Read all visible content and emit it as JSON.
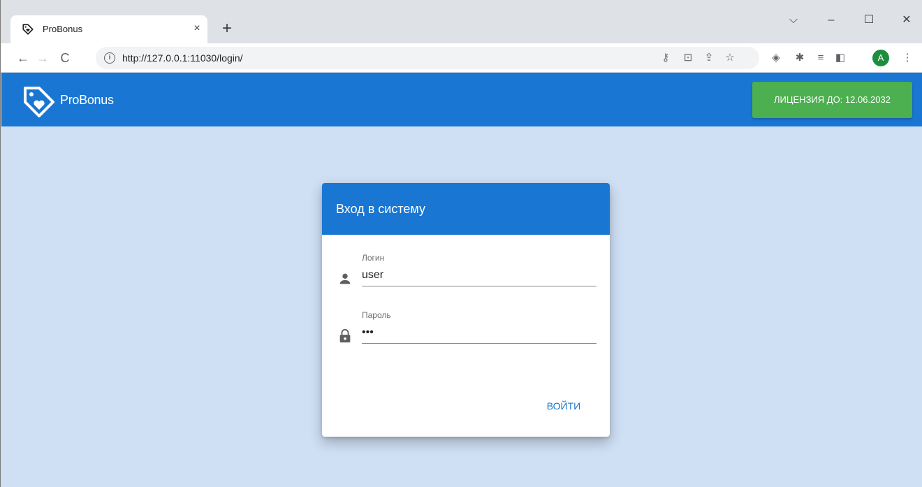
{
  "browser": {
    "tab_title": "ProBonus",
    "tab_close": "×",
    "new_tab": "+",
    "url": "http://127.0.0.1:11030/login/",
    "avatar_letter": "A"
  },
  "app": {
    "brand": "ProBonus",
    "license_label": "ЛИЦЕНЗИЯ ДО: 12.06.2032",
    "header_color": "#1976d2",
    "license_color": "#4caf50",
    "background_color": "#cfdff4"
  },
  "login": {
    "title": "Вход в систему",
    "username_label": "Логин",
    "username_value": "user",
    "password_label": "Пароль",
    "password_value": "•••",
    "submit_label": "ВОЙТИ"
  }
}
